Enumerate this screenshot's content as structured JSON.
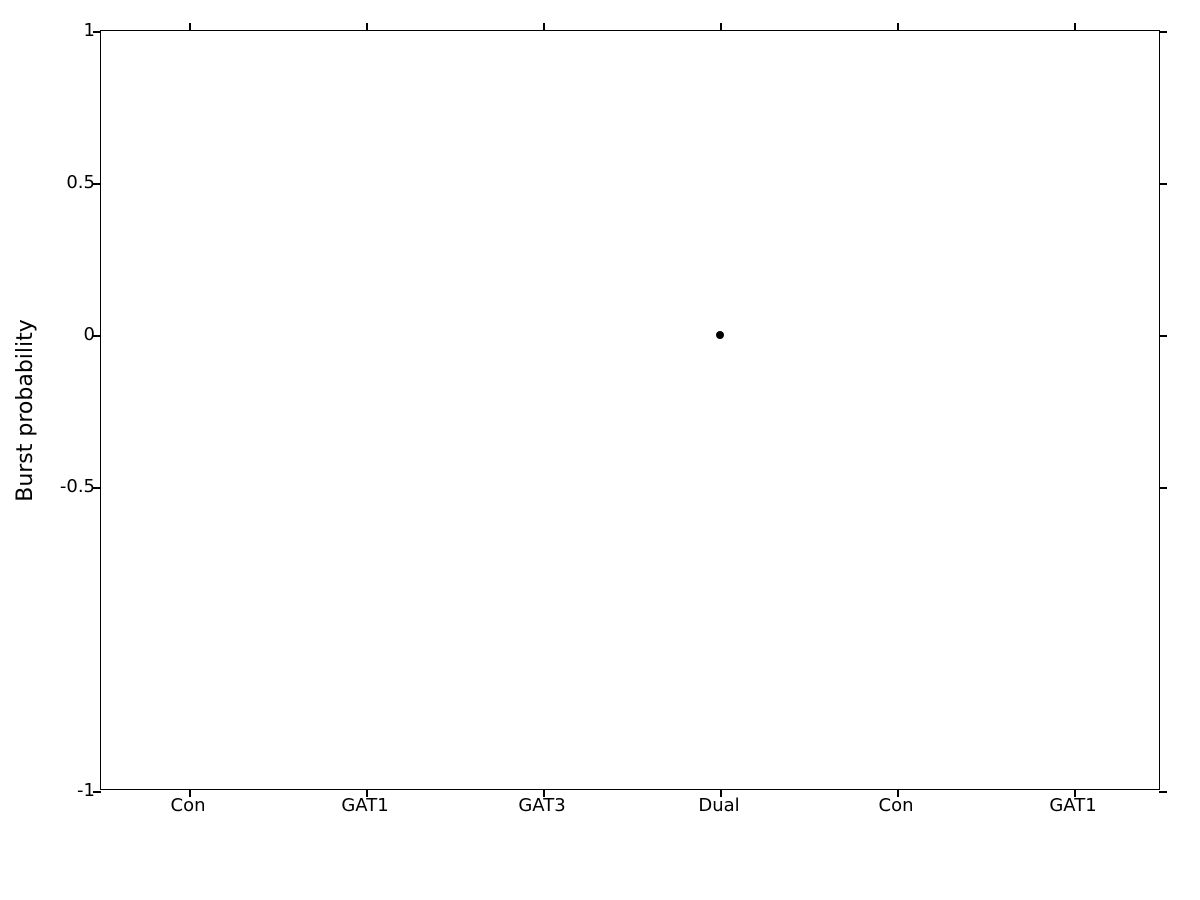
{
  "chart": {
    "title": "",
    "y_axis": {
      "label": "Burst probability",
      "min": -1,
      "max": 1,
      "ticks": [
        {
          "value": 1,
          "label": "1"
        },
        {
          "value": 0.5,
          "label": "0.5"
        },
        {
          "value": 0,
          "label": "0"
        },
        {
          "value": -0.5,
          "label": "-0.5"
        },
        {
          "value": -1,
          "label": "-1"
        }
      ]
    },
    "x_axis": {
      "labels": [
        "Con",
        "GAT1",
        "GAT3",
        "Dual",
        "Con",
        "GAT1"
      ]
    },
    "data_points": [
      {
        "x_index": 3,
        "y_value": 0.0
      }
    ]
  }
}
